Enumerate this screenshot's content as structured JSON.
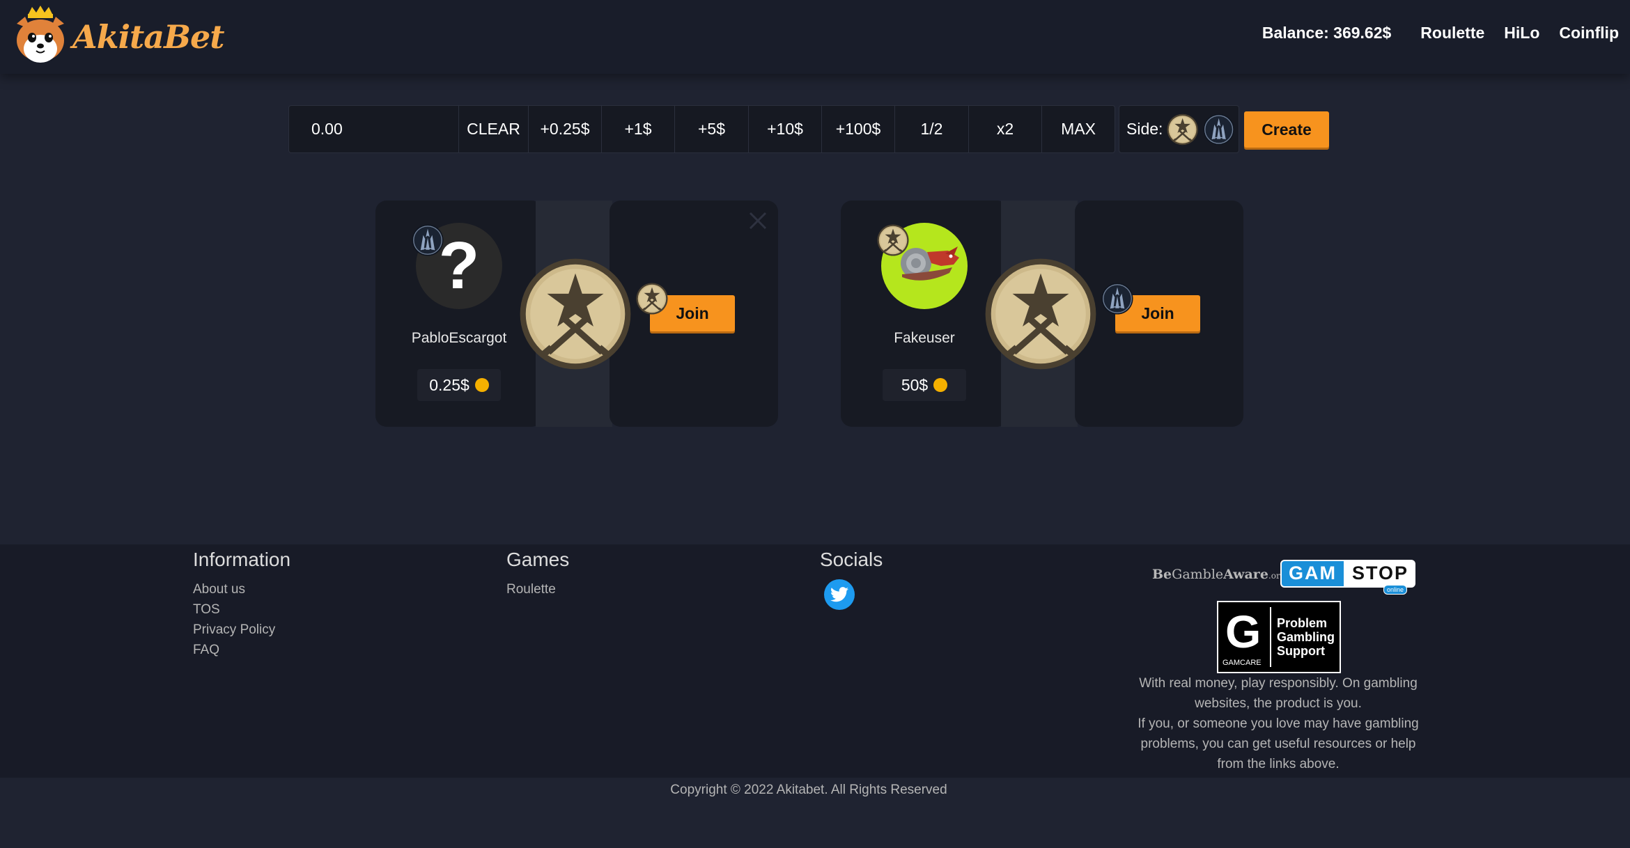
{
  "brand": {
    "name": "AkitaBet"
  },
  "nav": {
    "balance": "Balance: 369.62$",
    "links": [
      "Roulette",
      "HiLo",
      "Coinflip"
    ]
  },
  "betbar": {
    "amount_value": "0.00",
    "buttons": [
      "CLEAR",
      "+0.25$",
      "+1$",
      "+5$",
      "+10$",
      "+100$",
      "1/2",
      "x2",
      "MAX"
    ],
    "side_label": "Side:",
    "create_label": "Create"
  },
  "games": [
    {
      "username": "PabloEscargot",
      "amount": "0.25$",
      "avatar": "question-mark",
      "player_side": "ct",
      "join_label": "Join",
      "join_side": "t",
      "question": "?"
    },
    {
      "username": "Fakeuser",
      "amount": "50$",
      "avatar": "snail-dragon",
      "player_side": "t",
      "join_label": "Join",
      "join_side": "ct"
    }
  ],
  "footer": {
    "information": {
      "title": "Information",
      "links": [
        "About us",
        "TOS",
        "Privacy Policy",
        "FAQ"
      ]
    },
    "games": {
      "title": "Games",
      "links": [
        "Roulette"
      ]
    },
    "socials": {
      "title": "Socials",
      "icons": [
        "twitter-icon"
      ]
    },
    "begambleaware": {
      "be": "Be",
      "gamble": "Gamble",
      "aware": "Aware",
      "org": ".org"
    },
    "gamstop": {
      "gam": "GAM",
      "stop": "STOP",
      "online": "online"
    },
    "gamcare": {
      "letter": "G",
      "name": "GAMCARE",
      "line1": "Problem",
      "line2": "Gambling",
      "line3": "Support"
    },
    "responsible_line1": "With real money, play responsibly. On gambling websites, the product is you.",
    "responsible_line2": "If you, or someone you love may have gambling problems, you can get useful resources or help from the links above.",
    "copyright": "Copyright © 2022 Akitabet. All Rights Reserved"
  },
  "colors": {
    "accent": "#f7931e",
    "bg": "#1f2331",
    "header": "#191d2a",
    "coin_gold": "#f5b000"
  }
}
